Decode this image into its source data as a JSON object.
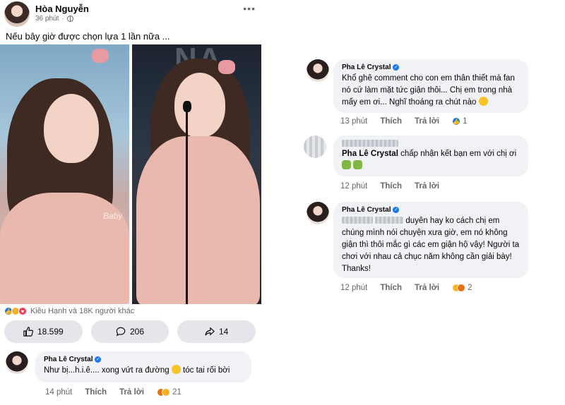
{
  "post": {
    "author": "Hòa Nguyễn",
    "time": "36 phút",
    "caption": "Nếu bây giờ được chọn lựa 1 lần nữa ...",
    "photo_watermark": "Baby",
    "stage_text": "NA",
    "reactions_summary": "Kiều Hạnh và 18K người khác",
    "like_count": "18.599",
    "comment_count": "206",
    "share_count": "14"
  },
  "comments": [
    {
      "author": "Pha Lê Crystal",
      "text_before": "Như bị...h.i.ê.... xong vứt ra đường ",
      "text_after": " tóc tai rối bời",
      "time": "14 phút",
      "like_label": "Thích",
      "reply_label": "Trả lời",
      "reaction_count": "21"
    },
    {
      "author": "Pha Lê Crystal",
      "text": "Khổ ghê comment cho con em thân thiết mà fan nó cứ làm mặt tức giận thôi... Chị em trong nhà mấy em ơi... Nghĩ thoáng ra chút nào ",
      "time": "13 phút",
      "like_label": "Thích",
      "reply_label": "Trả lời",
      "reaction_count": "1"
    },
    {
      "tagged_name": "Pha Lê Crystal",
      "text": " chấp nhận kết bạn em với chị ơi",
      "time": "12 phút",
      "like_label": "Thích",
      "reply_label": "Trả lời"
    },
    {
      "author": "Pha Lê Crystal",
      "text_line_1": " duyên hay ko cách chị em",
      "text_rest": "chúng mình nói chuyện xưa giờ, em nó không giận thì thôi mắc gì các em giận hộ vậy! Người ta chơi với nhau cả chục năm không cần giải bày! Thanks!",
      "time": "12 phút",
      "like_label": "Thích",
      "reply_label": "Trả lời",
      "reaction_count": "2"
    }
  ],
  "colors": {
    "facebook_blue": "#1877f2",
    "bubble_bg": "#f0f2f5",
    "muted_text": "#65676b",
    "button_bg": "#e4e6eb"
  }
}
